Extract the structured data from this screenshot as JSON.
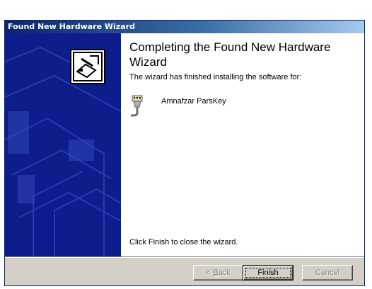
{
  "window": {
    "title": "Found New Hardware Wizard"
  },
  "main": {
    "heading": "Completing the Found New Hardware Wizard",
    "description": "The wizard has finished installing the software for:",
    "device_name": "Amnafzar ParsKey",
    "device_icon": "serial-device-icon",
    "footer": "Click Finish to close the wizard."
  },
  "buttons": {
    "back_mnemonic": "B",
    "back_rest": "ack",
    "back_prefix": "< ",
    "finish": "Finish",
    "cancel": "Cancel"
  },
  "colors": {
    "title_start": "#0a246a",
    "title_end": "#a6caf0",
    "side_panel": "#0d1e8c",
    "face": "#d4d0c8"
  }
}
